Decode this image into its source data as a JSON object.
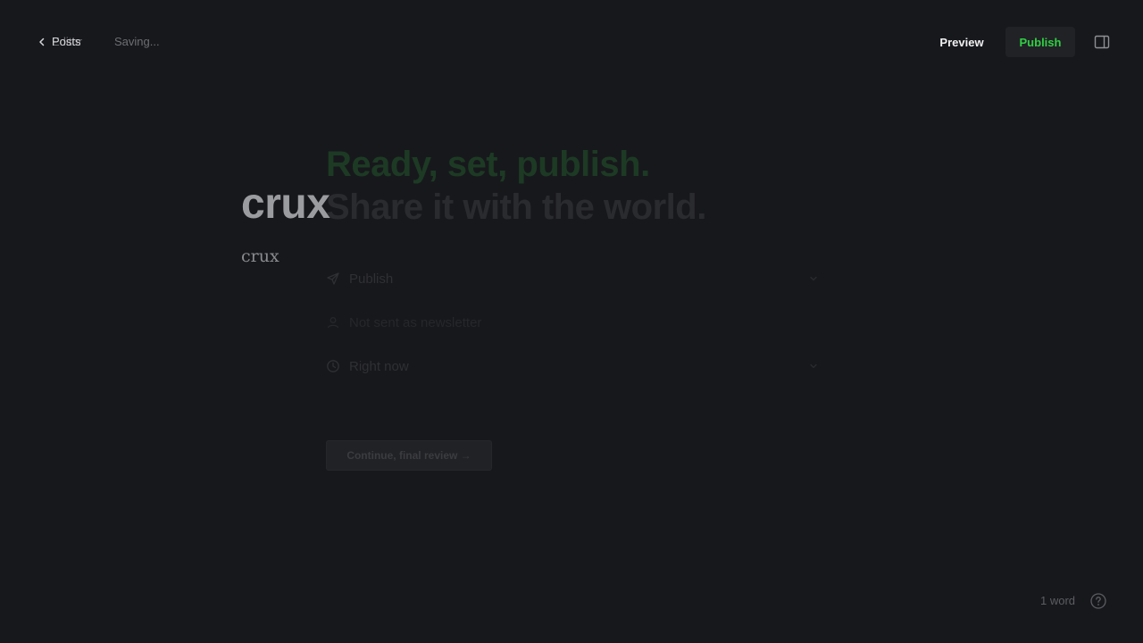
{
  "header": {
    "back_label_front": "Posts",
    "back_label_overlap": "Editor",
    "status": "Saving...",
    "preview_label": "Preview",
    "publish_label": "Publish"
  },
  "editor": {
    "title": "crux",
    "body": "crux"
  },
  "publish_flow": {
    "headline_line1": "Ready, set, publish.",
    "headline_line2": "Share it with the world.",
    "options": [
      {
        "label": "Publish",
        "icon": "send-icon"
      },
      {
        "label": "Not sent as newsletter",
        "icon": "user-icon"
      },
      {
        "label": "Right now",
        "icon": "clock-icon"
      }
    ],
    "continue_label": "Continue, final review →"
  },
  "footer": {
    "word_count": "1 word"
  },
  "colors": {
    "background": "#17181c",
    "accent_green": "#30cf43"
  }
}
